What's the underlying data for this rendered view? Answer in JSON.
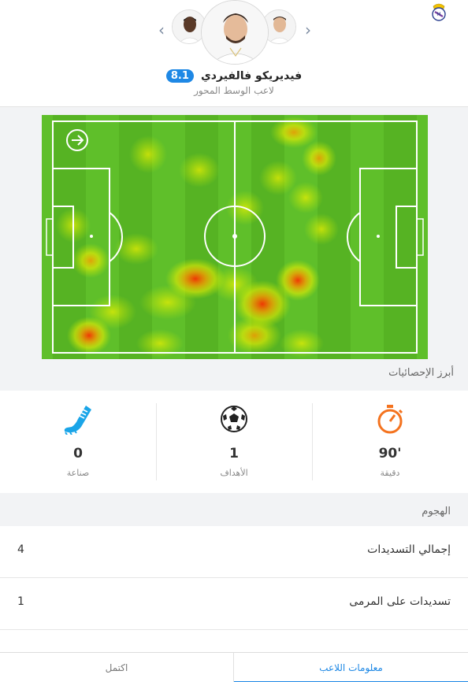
{
  "player": {
    "name": "فيديريكو فالفيردي",
    "rating": "8.1",
    "position": "لاعب الوسط المحور"
  },
  "icons": {
    "club": "club-crest-icon",
    "prev": "chevron-left-icon",
    "next": "chevron-right-icon",
    "direction": "arrow-right-icon"
  },
  "pitch": {
    "grass_color": "#5fbf2a",
    "stripe_color": "#56b323",
    "attack_direction": "right"
  },
  "highlights": {
    "title": "أبرز الإحصائيات",
    "items": [
      {
        "value": "90'",
        "label": "دقيقة",
        "icon": "stopwatch-icon",
        "color": "#f4731f"
      },
      {
        "value": "1",
        "label": "الأهداف",
        "icon": "football-icon",
        "color": "#222222"
      },
      {
        "value": "0",
        "label": "صناعة",
        "icon": "boot-icon",
        "color": "#1aa5e8"
      }
    ]
  },
  "attack": {
    "title": "الهجوم",
    "rows": [
      {
        "label": "إجمالي التسديدات",
        "value": "4"
      },
      {
        "label": "تسديدات على المرمى",
        "value": "1"
      }
    ]
  },
  "tabs": {
    "player_info": "معلومات اللاعب",
    "lineup": "اكتمل"
  }
}
